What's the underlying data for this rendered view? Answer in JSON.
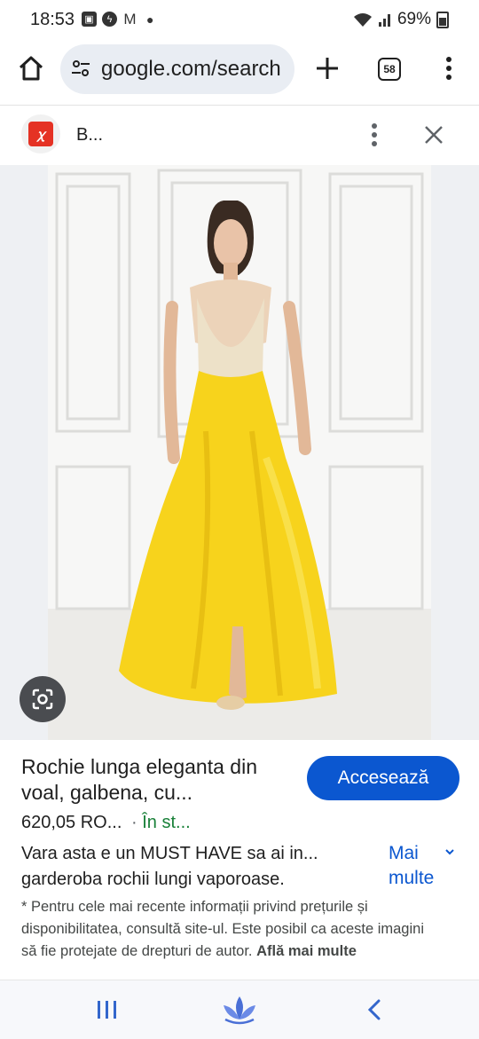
{
  "status_bar": {
    "time": "18:53",
    "battery": "69%",
    "notification_icons": [
      "gallery-icon",
      "messenger-icon",
      "gmail-icon"
    ]
  },
  "browser": {
    "url": "google.com/search",
    "tab_count": "58"
  },
  "result_sheet": {
    "site_name": "B...",
    "title": "Rochie lunga eleganta din voal, galbena, cu...",
    "visit_button": "Accesează",
    "price": "620,05 RO...",
    "availability": "În st...",
    "description": "Vara asta e un MUST HAVE sa ai in... garderoba rochii lungi vaporoase.",
    "more_label": "Mai multe",
    "disclaimer": "* Pentru cele mai recente informații privind prețurile și disponibilitatea, consultă site-ul. Este posibil ca aceste imagini să fie protejate de drepturi de autor.",
    "learn_more": "Află mai multe"
  },
  "colors": {
    "accent": "#0b57d0",
    "in_stock": "#188038",
    "dress": "#f7d31c"
  }
}
